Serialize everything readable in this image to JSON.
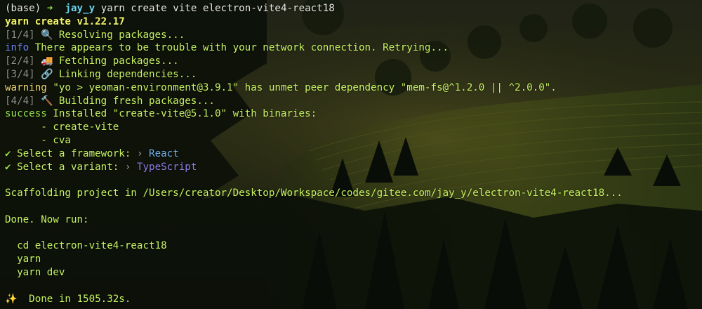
{
  "prompt": {
    "env": "(base)",
    "arrow": "➜",
    "user": "jay_y",
    "command": "yarn create vite electron-vite4-react18"
  },
  "yarn_header": "yarn create v1.22.17",
  "steps": [
    {
      "num": "[1/4]",
      "icon": "🔍",
      "icon_name": "magnifier-icon",
      "text": "Resolving packages..."
    },
    {
      "num": "[2/4]",
      "icon": "🚚",
      "icon_name": "truck-icon",
      "text": "Fetching packages..."
    },
    {
      "num": "[3/4]",
      "icon": "🔗",
      "icon_name": "link-icon",
      "text": "Linking dependencies..."
    },
    {
      "num": "[4/4]",
      "icon": "🔨",
      "icon_name": "hammer-icon",
      "text": "Building fresh packages..."
    }
  ],
  "info": {
    "tag": "info",
    "text": "There appears to be trouble with your network connection. Retrying..."
  },
  "warning": {
    "tag": "warning",
    "text": "\"yo > yeoman-environment@3.9.1\" has unmet peer dependency \"mem-fs@^1.2.0 || ^2.0.0\"."
  },
  "success": {
    "tag": "success",
    "text": "Installed \"create-vite@5.1.0\" with binaries:"
  },
  "binaries": [
    "- create-vite",
    "- cva"
  ],
  "selections": [
    {
      "check": "✔",
      "label": "Select a framework:",
      "sep": "›",
      "value": "React"
    },
    {
      "check": "✔",
      "label": "Select a variant:",
      "sep": "›",
      "value": "TypeScript"
    }
  ],
  "scaffolding": "Scaffolding project in /Users/creator/Desktop/Workspace/codes/gitee.com/jay_y/electron-vite4-react18...",
  "done_now_run": "Done. Now run:",
  "run_commands": [
    "cd electron-vite4-react18",
    "yarn",
    "yarn dev"
  ],
  "final": {
    "icon": "✨",
    "icon_name": "sparkles-icon",
    "text": "Done in 1505.32s."
  },
  "colors": {
    "prompt_user": "#6bd3ee",
    "yarn_header": "#f2f266",
    "step_text": "#c7f262",
    "info_tag": "#6c83f0",
    "warning_tag": "#ecd672",
    "checkmark": "#95e048",
    "framework_value": "#6faee8",
    "variant_value": "#8f7de6"
  }
}
